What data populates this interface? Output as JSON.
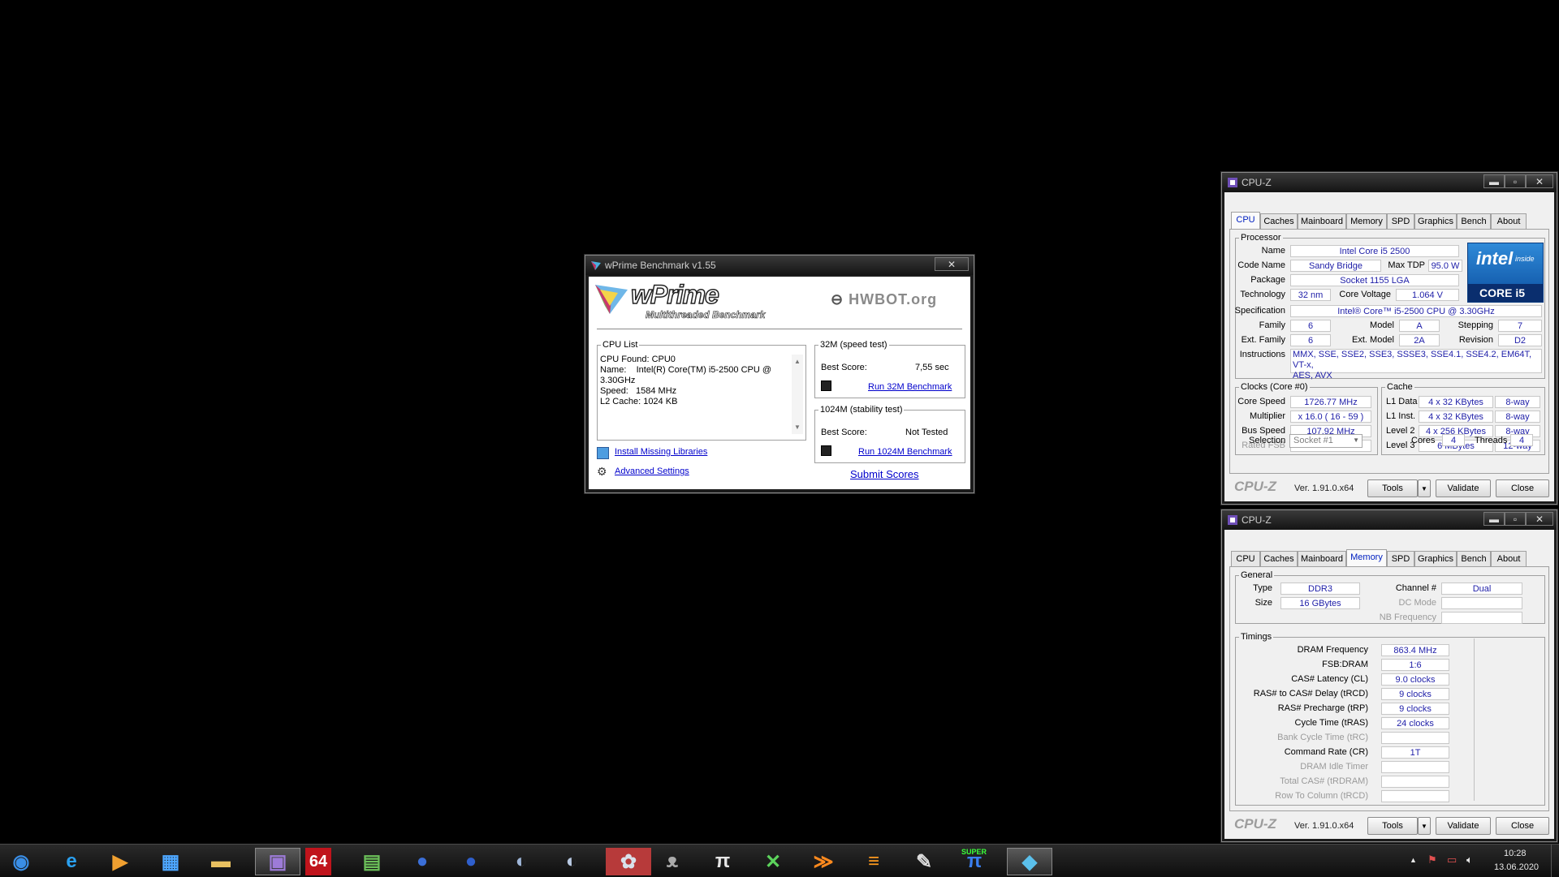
{
  "wprime": {
    "title": "wPrime Benchmark v1.55",
    "close_glyph": "✕",
    "logo_text": "wPrime",
    "logo_subtitle": "Multithreaded Benchmark",
    "hwbot_text": "HWBOT.org",
    "cpu_list": {
      "legend": "CPU List",
      "lines": [
        "CPU Found: CPU0",
        "Name:    Intel(R) Core(TM) i5-2500 CPU @",
        "3.30GHz",
        "Speed:   1584 MHz",
        "L2 Cache: 1024 KB"
      ]
    },
    "install_link": "Install Missing Libraries",
    "advanced_link": "Advanced Settings",
    "test32": {
      "legend": "32M (speed test)",
      "best_label": "Best Score:",
      "best_value": "7,55 sec",
      "run_link": "Run 32M Benchmark"
    },
    "test1024": {
      "legend": "1024M (stability test)",
      "best_label": "Best Score:",
      "best_value": "Not Tested",
      "run_link": "Run 1024M Benchmark"
    },
    "submit_link": "Submit Scores"
  },
  "cpuz_common": {
    "title": "CPU-Z",
    "tabs": [
      "CPU",
      "Caches",
      "Mainboard",
      "Memory",
      "SPD",
      "Graphics",
      "Bench",
      "About"
    ],
    "brand": "CPU-Z",
    "version": "Ver. 1.91.0.x64",
    "tools": "Tools",
    "validate": "Validate",
    "close": "Close",
    "min_glyph": "▬",
    "max_glyph": "▫",
    "close_glyph": "✕"
  },
  "cpuz_cpu": {
    "active_tab": "CPU",
    "processor_legend": "Processor",
    "name_label": "Name",
    "name": "Intel Core i5 2500",
    "codename_label": "Code Name",
    "codename": "Sandy Bridge",
    "maxtdp_label": "Max TDP",
    "maxtdp": "95.0 W",
    "package_label": "Package",
    "package": "Socket 1155 LGA",
    "technology_label": "Technology",
    "technology": "32 nm",
    "corevoltage_label": "Core Voltage",
    "corevoltage": "1.064 V",
    "spec_label": "Specification",
    "spec": "Intel® Core™ i5-2500 CPU @ 3.30GHz",
    "family_label": "Family",
    "family": "6",
    "model_label": "Model",
    "model": "A",
    "stepping_label": "Stepping",
    "stepping": "7",
    "extfamily_label": "Ext. Family",
    "extfamily": "6",
    "extmodel_label": "Ext. Model",
    "extmodel": "2A",
    "revision_label": "Revision",
    "revision": "D2",
    "instructions_label": "Instructions",
    "instructions": "MMX, SSE, SSE2, SSE3, SSSE3, SSE4.1, SSE4.2, EM64T, VT-x,",
    "instructions2": "AES, AVX",
    "intel_badge_top": "intel",
    "intel_badge_inside": "inside",
    "intel_badge_bottom": "CORE i5",
    "clocks_legend": "Clocks (Core #0)",
    "corespeed_label": "Core Speed",
    "corespeed": "1726.77 MHz",
    "multiplier_label": "Multiplier",
    "multiplier": "x 16.0 ( 16 - 59 )",
    "busspeed_label": "Bus Speed",
    "busspeed": "107.92 MHz",
    "ratedfsb_label": "Rated FSB",
    "cache_legend": "Cache",
    "l1data_label": "L1 Data",
    "l1data": "4 x 32 KBytes",
    "l1data_way": "8-way",
    "l1inst_label": "L1 Inst.",
    "l1inst": "4 x 32 KBytes",
    "l1inst_way": "8-way",
    "l2_label": "Level 2",
    "l2": "4 x 256 KBytes",
    "l2_way": "8-way",
    "l3_label": "Level 3",
    "l3": "6 MBytes",
    "l3_way": "12-way",
    "selection_label": "Selection",
    "selection": "Socket #1",
    "cores_label": "Cores",
    "cores": "4",
    "threads_label": "Threads",
    "threads": "4"
  },
  "cpuz_mem": {
    "active_tab": "Memory",
    "general_legend": "General",
    "type_label": "Type",
    "type": "DDR3",
    "size_label": "Size",
    "size": "16 GBytes",
    "channel_label": "Channel #",
    "channel": "Dual",
    "dcmode_label": "DC Mode",
    "nbfreq_label": "NB Frequency",
    "timings_legend": "Timings",
    "timings": [
      {
        "label": "DRAM Frequency",
        "value": "863.4 MHz",
        "dim": false
      },
      {
        "label": "FSB:DRAM",
        "value": "1:6",
        "dim": false
      },
      {
        "label": "CAS# Latency (CL)",
        "value": "9.0 clocks",
        "dim": false
      },
      {
        "label": "RAS# to CAS# Delay (tRCD)",
        "value": "9 clocks",
        "dim": false
      },
      {
        "label": "RAS# Precharge (tRP)",
        "value": "9 clocks",
        "dim": false
      },
      {
        "label": "Cycle Time (tRAS)",
        "value": "24 clocks",
        "dim": false
      },
      {
        "label": "Bank Cycle Time (tRC)",
        "value": "",
        "dim": true
      },
      {
        "label": "Command Rate (CR)",
        "value": "1T",
        "dim": false
      },
      {
        "label": "DRAM Idle Timer",
        "value": "",
        "dim": true
      },
      {
        "label": "Total CAS# (tRDRAM)",
        "value": "",
        "dim": true
      },
      {
        "label": "Row To Column (tRCD)",
        "value": "",
        "dim": true
      }
    ]
  },
  "taskbar": {
    "icons": [
      {
        "name": "start-orb-icon",
        "glyph": "◉",
        "color": "#3a8ee6"
      },
      {
        "name": "internet-explorer-icon",
        "glyph": "e",
        "color": "#2aa0f0"
      },
      {
        "name": "media-player-icon",
        "glyph": "▶",
        "color": "#f0a030"
      },
      {
        "name": "calculator-app-icon",
        "glyph": "▦",
        "color": "#4da6ff"
      },
      {
        "name": "file-explorer-icon",
        "glyph": "▬",
        "color": "#e8c060"
      },
      {
        "name": "cpuz-app-icon",
        "glyph": "▣",
        "color": "#9d7bd8"
      },
      {
        "name": "aida64-icon",
        "glyph": "64",
        "color": "#ffffff"
      },
      {
        "name": "gpu-tool-icon",
        "glyph": "▤",
        "color": "#6bbf59"
      },
      {
        "name": "blue-sphere-icon-1",
        "glyph": "●",
        "color": "#3b6fd8"
      },
      {
        "name": "blue-sphere-icon-2",
        "glyph": "●",
        "color": "#2f5fcc"
      },
      {
        "name": "cinebench-icon-1",
        "glyph": "◐",
        "color": "#9fb6d8"
      },
      {
        "name": "cinebench-icon-2",
        "glyph": "◐",
        "color": "#b8c9e2"
      },
      {
        "name": "fan-tool-icon",
        "glyph": "✿",
        "color": "#d9e0ea"
      },
      {
        "name": "cat-app-icon",
        "glyph": "ᴥ",
        "color": "#aaaaaa"
      },
      {
        "name": "superpi-icon",
        "glyph": "π",
        "color": "#e6e6e6"
      },
      {
        "name": "xbox-icon",
        "glyph": "✕",
        "color": "#5cd35c"
      },
      {
        "name": "bolt-app-icon",
        "glyph": "≫",
        "color": "#ff8a1e"
      },
      {
        "name": "orange-circle-icon",
        "glyph": "≡",
        "color": "#ff9a1e"
      },
      {
        "name": "tool-icon",
        "glyph": "✎",
        "color": "#dddddd"
      },
      {
        "name": "super-app-icon",
        "glyph": "π",
        "color": "#3a7ff0"
      },
      {
        "name": "wprime-taskbar-icon",
        "glyph": "◆",
        "color": "#5bc0eb"
      }
    ],
    "aida64_label": "64",
    "super_label": "SUPER",
    "time": "10:28",
    "date": "13.06.2020"
  }
}
